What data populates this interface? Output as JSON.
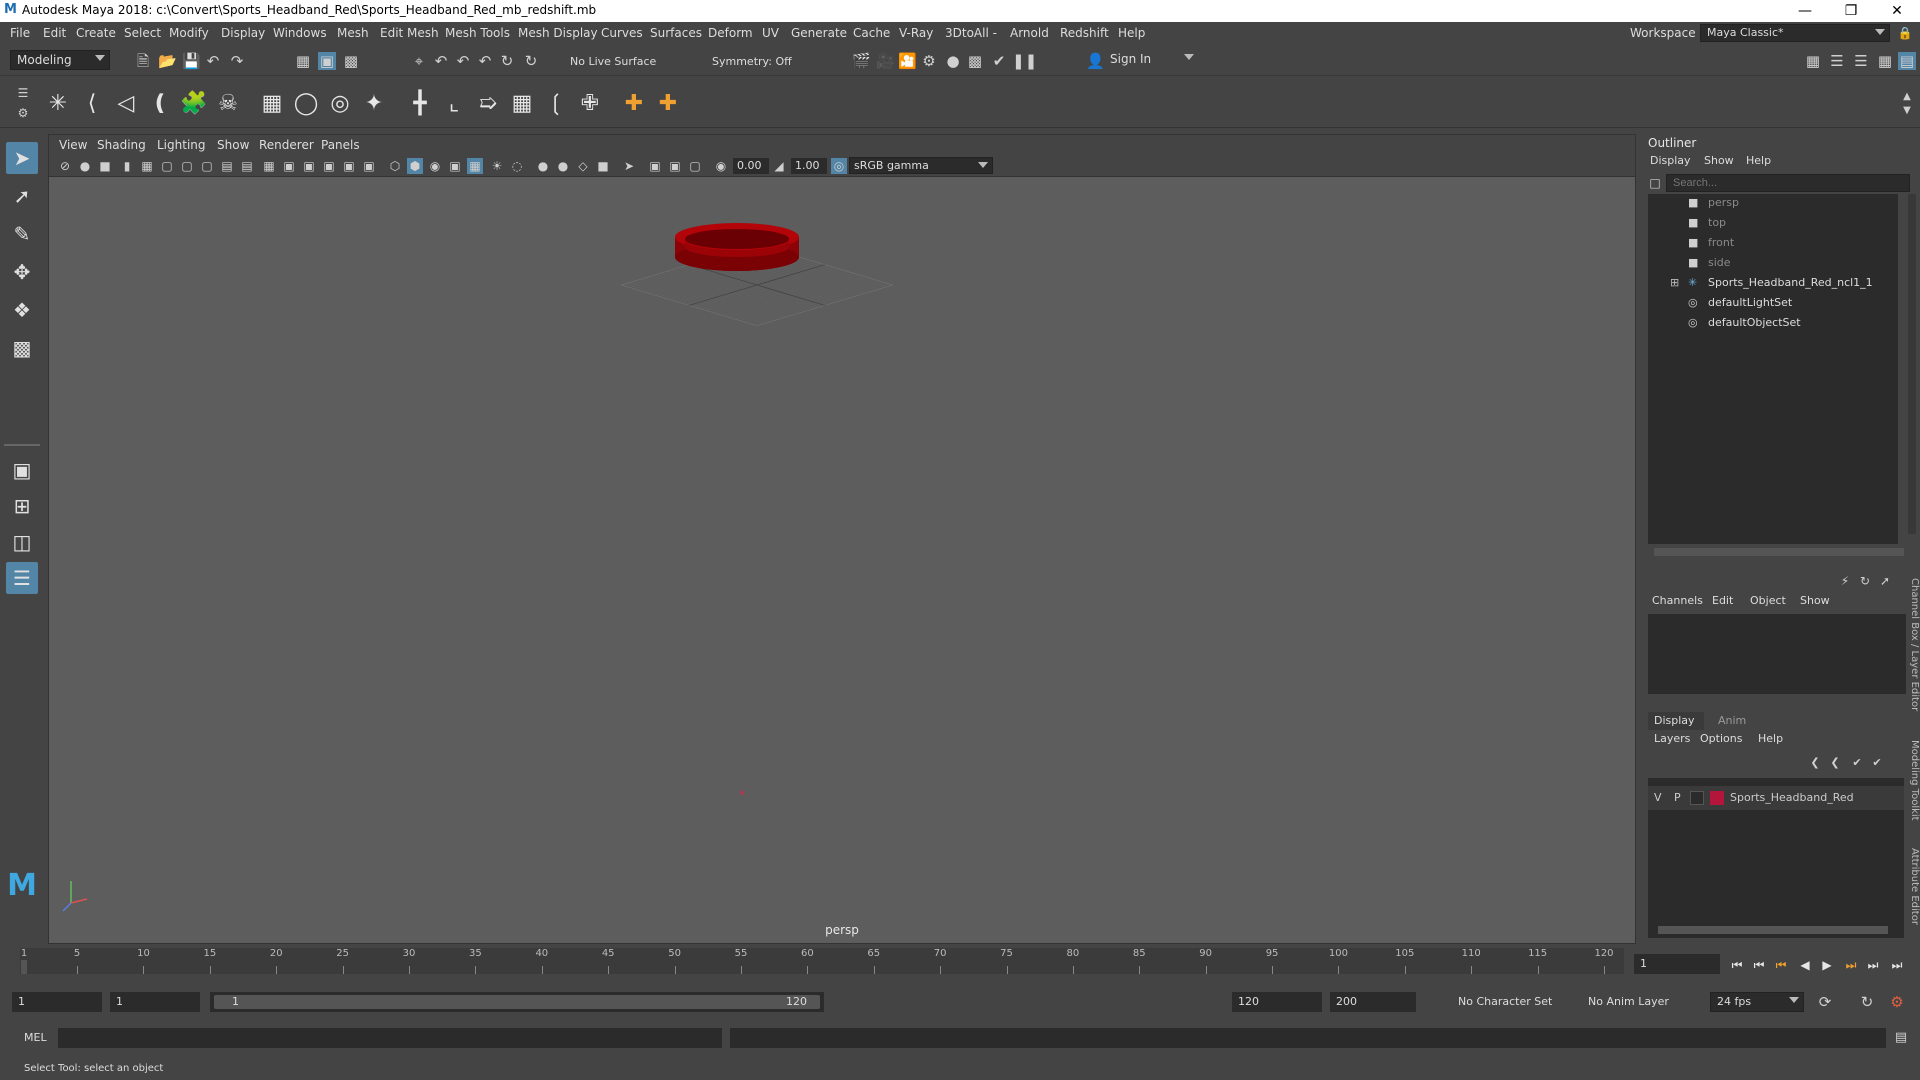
{
  "window": {
    "title": "Autodesk Maya 2018: c:\\Convert\\Sports_Headband_Red\\Sports_Headband_Red_mb_redshift.mb",
    "logo": "M"
  },
  "menubar": {
    "items": [
      "File",
      "Edit",
      "Create",
      "Select",
      "Modify",
      "Display",
      "Windows",
      "Mesh",
      "Edit Mesh",
      "Mesh Tools",
      "Mesh Display",
      "Curves",
      "Surfaces",
      "Deform",
      "UV",
      "Generate",
      "Cache",
      "V-Ray",
      "3DtoAll -",
      "Arnold",
      "Redshift",
      "Help"
    ],
    "workspace_label": "Workspace :",
    "workspace_value": "Maya Classic*"
  },
  "statusline": {
    "menuset": "Modeling",
    "live_surface": "No Live Surface",
    "symmetry": "Symmetry: Off",
    "sign_in": "Sign In"
  },
  "viewport": {
    "menus": [
      "View",
      "Shading",
      "Lighting",
      "Show",
      "Renderer",
      "Panels"
    ],
    "exposure": "0.00",
    "gamma": "1.00",
    "color_space": "sRGB gamma",
    "camera": "persp",
    "object_color": "#b3040a"
  },
  "outliner": {
    "title": "Outliner",
    "menus": [
      "Display",
      "Show",
      "Help"
    ],
    "search_placeholder": "Search...",
    "items": [
      {
        "label": "persp",
        "icon": "camera-icon",
        "dim": true
      },
      {
        "label": "top",
        "icon": "camera-icon",
        "dim": true
      },
      {
        "label": "front",
        "icon": "camera-icon",
        "dim": true
      },
      {
        "label": "side",
        "icon": "camera-icon",
        "dim": true
      },
      {
        "label": "Sports_Headband_Red_ncl1_1",
        "icon": "transform-icon",
        "dim": false
      },
      {
        "label": "defaultLightSet",
        "icon": "set-icon",
        "dim": false
      },
      {
        "label": "defaultObjectSet",
        "icon": "set-icon",
        "dim": false
      }
    ]
  },
  "channel_box": {
    "menus": [
      "Channels",
      "Edit",
      "Object",
      "Show"
    ],
    "side_tab": "Channel Box / Layer Editor"
  },
  "layer_editor": {
    "tabs": [
      "Display",
      "Anim"
    ],
    "menus": [
      "Layers",
      "Options",
      "Help"
    ],
    "layer": {
      "v": "V",
      "p": "P",
      "name": "Sports_Headband_Red",
      "color": "#b3163a"
    },
    "side_tabs": [
      "Modeling Toolkit",
      "Attribute Editor"
    ]
  },
  "timeslider": {
    "ticks": [
      "1",
      "5",
      "10",
      "15",
      "20",
      "25",
      "30",
      "35",
      "40",
      "45",
      "50",
      "55",
      "60",
      "65",
      "70",
      "75",
      "80",
      "85",
      "90",
      "95",
      "100",
      "105",
      "110",
      "115",
      "120"
    ],
    "current_frame": "1"
  },
  "rangeslider": {
    "start": "1",
    "playback_start": "1",
    "range_start_label": "1",
    "range_end_label": "120",
    "playback_end": "120",
    "end": "200",
    "character_set": "No Character Set",
    "anim_layer": "No Anim Layer",
    "fps": "24 fps"
  },
  "cmdline": {
    "label": "MEL"
  },
  "helpline": {
    "text": "Select Tool: select an object"
  }
}
